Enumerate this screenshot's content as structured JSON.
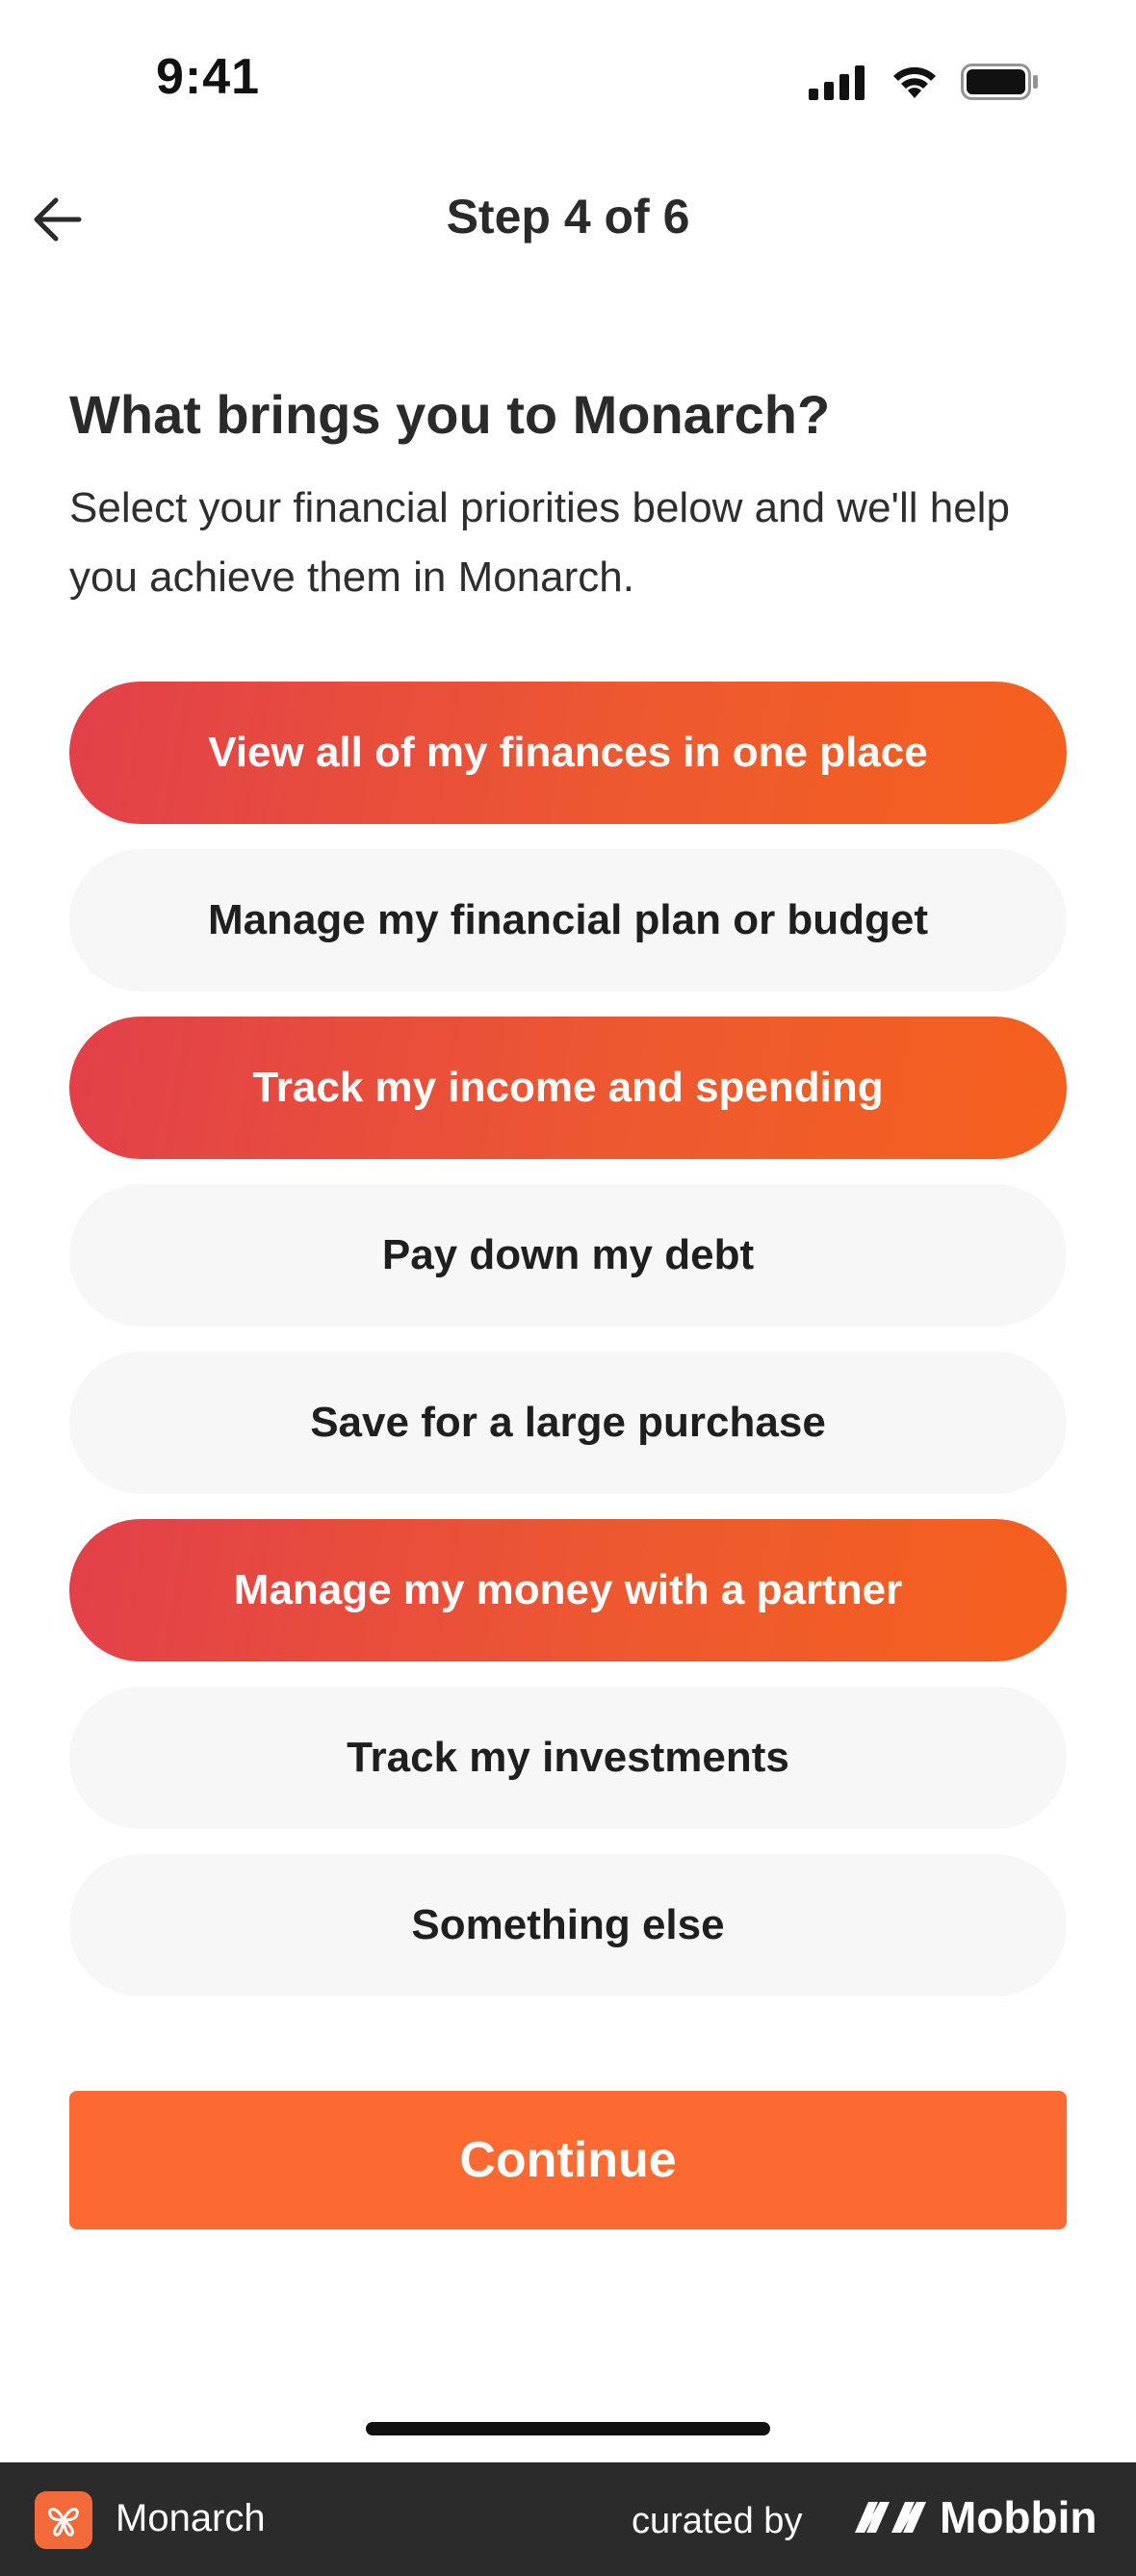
{
  "status_bar": {
    "time": "9:41"
  },
  "header": {
    "step_label": "Step 4 of 6",
    "back_icon": "arrow-left-icon"
  },
  "content": {
    "question": "What brings you to Monarch?",
    "subtitle": "Select your financial priorities below and we'll help you achieve them in Monarch."
  },
  "options": [
    {
      "label": "View all of my finances in one place",
      "selected": true
    },
    {
      "label": "Manage my financial plan or budget",
      "selected": false
    },
    {
      "label": "Track my income and spending",
      "selected": true
    },
    {
      "label": "Pay down my debt",
      "selected": false
    },
    {
      "label": "Save for a large purchase",
      "selected": false
    },
    {
      "label": "Manage my money with a partner",
      "selected": true
    },
    {
      "label": "Track my investments",
      "selected": false
    },
    {
      "label": "Something else",
      "selected": false
    }
  ],
  "continue_label": "Continue",
  "footer": {
    "app_name": "Monarch",
    "curated_by": "curated by",
    "brand": "Mobbin"
  },
  "colors": {
    "accent": "#fd6a31",
    "selected_gradient_start": "#e2404a",
    "selected_gradient_end": "#f5601d",
    "unselected_bg": "#f7f7f7",
    "footer_bg": "#2b2b2b"
  }
}
